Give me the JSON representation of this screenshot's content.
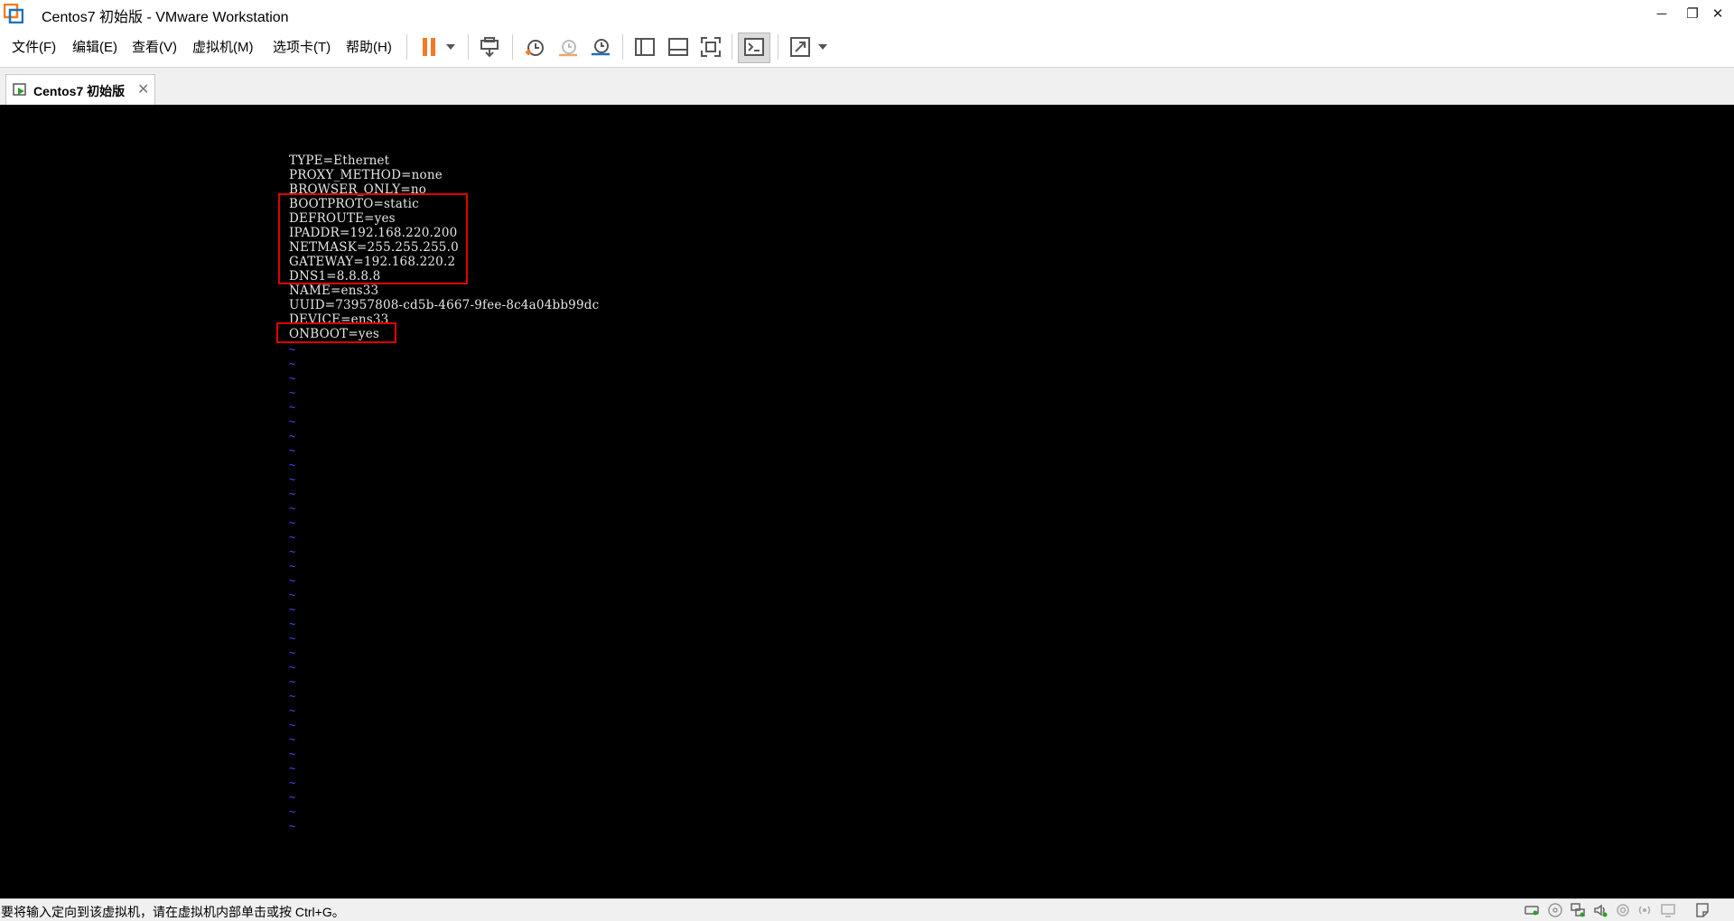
{
  "window": {
    "title": "Centos7 初始版 - VMware Workstation",
    "minimize_glyph": "─",
    "restore_glyph": "❐",
    "close_glyph": "✕"
  },
  "menu": {
    "items": [
      {
        "label": "文件(F)"
      },
      {
        "label": "编辑(E)"
      },
      {
        "label": "查看(V)"
      },
      {
        "label": "虚拟机(M)"
      },
      {
        "label": "选项卡(T)"
      },
      {
        "label": "帮助(H)"
      }
    ]
  },
  "toolbar": {
    "icons": [
      "pause-icon",
      "send-ctrl-alt-del-icon",
      "snapshot-take-icon",
      "snapshot-revert-icon",
      "snapshot-manager-icon",
      "show-library-icon",
      "show-thumbnail-icon",
      "full-screen-icon",
      "console-view-icon",
      "stretch-guest-icon"
    ],
    "accent": "#f07a26"
  },
  "tabs": [
    {
      "label": "Centos7 初始版",
      "close_glyph": "✕"
    }
  ],
  "console": {
    "lines": [
      "TYPE=Ethernet",
      "PROXY_METHOD=none",
      "BROWSER_ONLY=no",
      "BOOTPROTO=static",
      "DEFROUTE=yes",
      "IPADDR=192.168.220.200",
      "NETMASK=255.255.255.0",
      "GATEWAY=192.168.220.2",
      "DNS1=8.8.8.8",
      "NAME=ens33",
      "UUID=73957808-cd5b-4667-9fee-8c4a04bb99dc",
      "DEVICE=ens33",
      "ONBOOT=yes"
    ],
    "tilde": "~",
    "tilde_count": 34,
    "text_color": "#e6e6e6",
    "tilde_color": "#4a4aff",
    "highlight_color": "#e00000"
  },
  "statusbar": {
    "message": "要将输入定向到该虚拟机，请在虚拟机内部单击或按 Ctrl+G。",
    "icons": [
      "hard-disk-icon",
      "cd-dvd-icon",
      "network-adapter-icon",
      "sound-card-icon",
      "usb-icon",
      "printer-icon",
      "display-icon",
      "message-log-icon"
    ]
  }
}
